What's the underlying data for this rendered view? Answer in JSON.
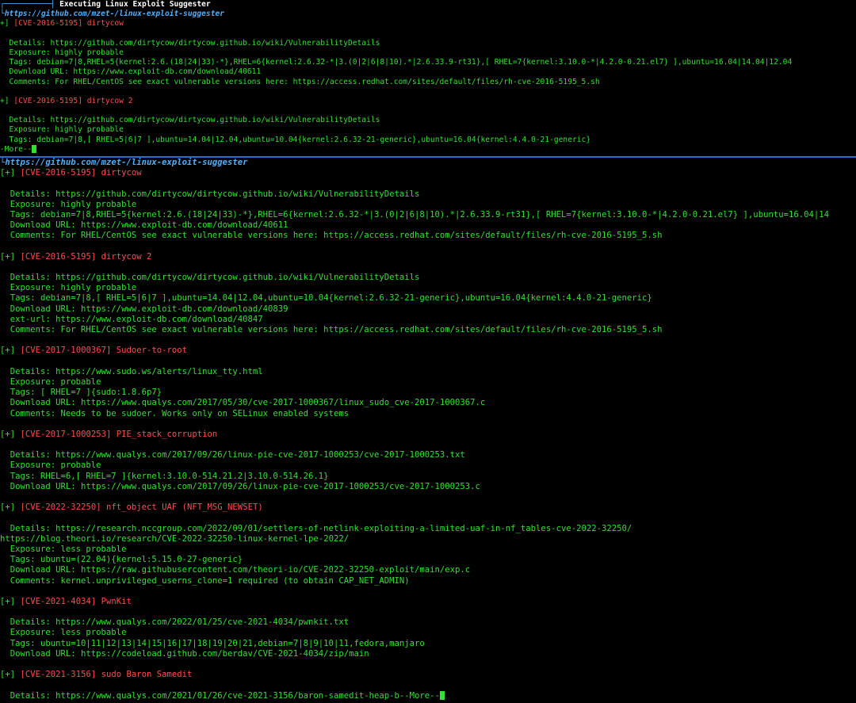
{
  "top_pane": {
    "banner_title": "Executing Linux Exploit Suggester",
    "url": "https://github.com/mzet-/linux-exploit-suggester",
    "entries": [
      {
        "cve": "[CVE-2016-5195]",
        "name": "dirtycow",
        "details": [
          "Details: https://github.com/dirtycow/dirtycow.github.io/wiki/VulnerabilityDetails",
          "Exposure: highly probable",
          "Tags: debian=7|8,RHEL=5{kernel:2.6.(18|24|33)-*},RHEL=6{kernel:2.6.32-*|3.(0|2|6|8|10).*|2.6.33.9-rt31},[ RHEL=7{kernel:3.10.0-*|4.2.0-0.21.el7} ],ubuntu=16.04|14.04|12.04",
          "Download URL: https://www.exploit-db.com/download/40611",
          "Comments: For RHEL/CentOS see exact vulnerable versions here: https://access.redhat.com/sites/default/files/rh-cve-2016-5195_5.sh"
        ]
      },
      {
        "cve": "[CVE-2016-5195]",
        "name": "dirtycow 2",
        "details": [
          "Details: https://github.com/dirtycow/dirtycow.github.io/wiki/VulnerabilityDetails",
          "Exposure: highly probable",
          "Tags: debian=7|8,[ RHEL=5|6|7 ],ubuntu=14.04|12.04,ubuntu=10.04{kernel:2.6.32-21-generic},ubuntu=16.04{kernel:4.4.0-21-generic}"
        ]
      }
    ],
    "more_prompt": "-More--"
  },
  "bottom_pane": {
    "url": "https://github.com/mzet-/linux-exploit-suggester",
    "plus": "[+]",
    "entries": [
      {
        "cve": "[CVE-2016-5195]",
        "name": "dirtycow",
        "details": [
          "Details: https://github.com/dirtycow/dirtycow.github.io/wiki/VulnerabilityDetails",
          "Exposure: highly probable",
          "Tags: debian=7|8,RHEL=5{kernel:2.6.(18|24|33)-*},RHEL=6{kernel:2.6.32-*|3.(0|2|6|8|10).*|2.6.33.9-rt31},[ RHEL=7{kernel:3.10.0-*|4.2.0-0.21.el7} ],ubuntu=16.04|14",
          "Download URL: https://www.exploit-db.com/download/40611",
          "Comments: For RHEL/CentOS see exact vulnerable versions here: https://access.redhat.com/sites/default/files/rh-cve-2016-5195_5.sh"
        ]
      },
      {
        "cve": "[CVE-2016-5195]",
        "name": "dirtycow 2",
        "details": [
          "Details: https://github.com/dirtycow/dirtycow.github.io/wiki/VulnerabilityDetails",
          "Exposure: highly probable",
          "Tags: debian=7|8,[ RHEL=5|6|7 ],ubuntu=14.04|12.04,ubuntu=10.04{kernel:2.6.32-21-generic},ubuntu=16.04{kernel:4.4.0-21-generic}",
          "Download URL: https://www.exploit-db.com/download/40839",
          "ext-url: https://www.exploit-db.com/download/40847",
          "Comments: For RHEL/CentOS see exact vulnerable versions here: https://access.redhat.com/sites/default/files/rh-cve-2016-5195_5.sh"
        ]
      },
      {
        "cve": "[CVE-2017-1000367]",
        "name": "Sudoer-to-root",
        "details": [
          "Details: https://www.sudo.ws/alerts/linux_tty.html",
          "Exposure: probable",
          "Tags: [ RHEL=7 ]{sudo:1.8.6p7}",
          "Download URL: https://www.qualys.com/2017/05/30/cve-2017-1000367/linux_sudo_cve-2017-1000367.c",
          "Comments: Needs to be sudoer. Works only on SELinux enabled systems"
        ]
      },
      {
        "cve": "[CVE-2017-1000253]",
        "name": "PIE_stack_corruption",
        "details": [
          "Details: https://www.qualys.com/2017/09/26/linux-pie-cve-2017-1000253/cve-2017-1000253.txt",
          "Exposure: probable",
          "Tags: RHEL=6,[ RHEL=7 ]{kernel:3.10.0-514.21.2|3.10.0-514.26.1}",
          "Download URL: https://www.qualys.com/2017/09/26/linux-pie-cve-2017-1000253/cve-2017-1000253.c"
        ]
      },
      {
        "cve": "[CVE-2022-32250]",
        "name": "nft_object UAF (NFT_MSG_NEWSET)",
        "details": [
          "Details: https://research.nccgroup.com/2022/09/01/settlers-of-netlink-exploiting-a-limited-uaf-in-nf_tables-cve-2022-32250/"
        ],
        "wrap": "https://blog.theori.io/research/CVE-2022-32250-linux-kernel-lpe-2022/",
        "details_after": [
          "Exposure: less probable",
          "Tags: ubuntu=(22.04){kernel:5.15.0-27-generic}",
          "Download URL: https://raw.githubusercontent.com/theori-io/CVE-2022-32250-exploit/main/exp.c",
          "Comments: kernel.unprivileged_userns_clone=1 required (to obtain CAP_NET_ADMIN)"
        ]
      },
      {
        "cve": "[CVE-2021-4034]",
        "name": "PwnKit",
        "details": [
          "Details: https://www.qualys.com/2022/01/25/cve-2021-4034/pwnkit.txt",
          "Exposure: less probable",
          "Tags: ubuntu=10|11|12|13|14|15|16|17|18|19|20|21,debian=7|8|9|10|11,fedora,manjaro",
          "Download URL: https://codeload.github.com/berdav/CVE-2021-4034/zip/main"
        ]
      },
      {
        "cve": "[CVE-2021-3156]",
        "name": "sudo Baron Samedit",
        "details": [
          "Details: https://www.qualys.com/2021/01/26/cve-2021-3156/baron-samedit-heap-b--More--"
        ]
      }
    ]
  }
}
